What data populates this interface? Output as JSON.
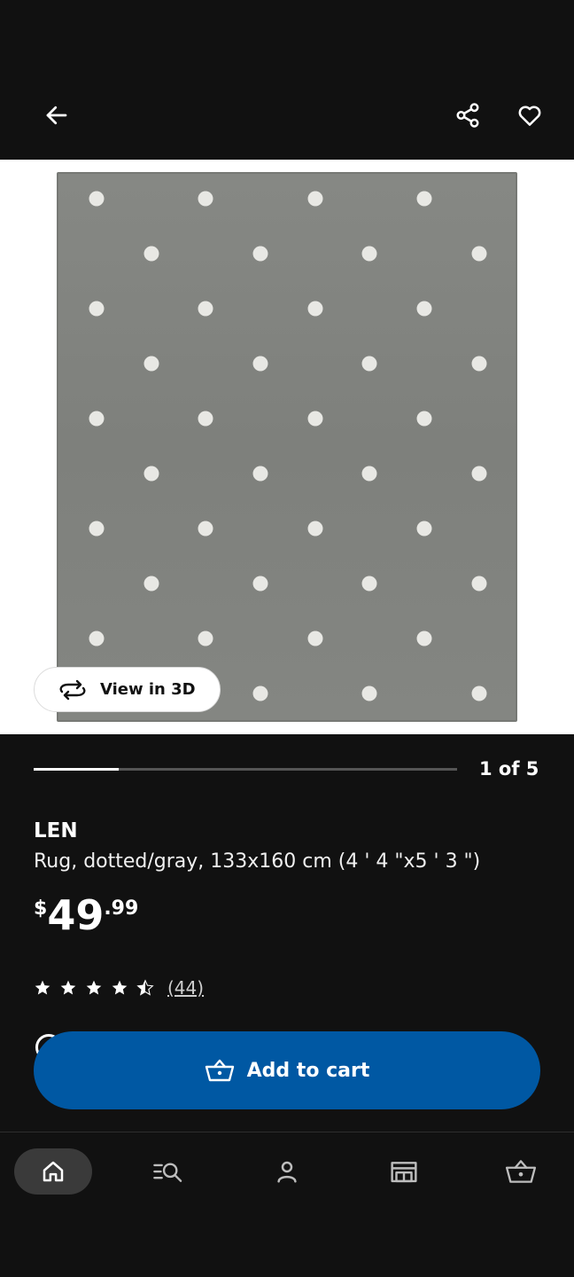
{
  "topbar": {
    "back_icon": "arrow-left-icon",
    "share_icon": "share-icon",
    "favorite_icon": "heart-icon"
  },
  "hero": {
    "view_3d_label": "View in 3D",
    "view_3d_icon": "rotate-3d-icon"
  },
  "gallery": {
    "progress_label": "1 of 5",
    "current": 1,
    "total": 5
  },
  "product": {
    "name": "LEN",
    "description": "Rug, dotted/gray, 133x160 cm (4 ' 4 \"x5 ' 3 \")",
    "price": {
      "currency": "$",
      "integer": "49",
      "decimal": ".99"
    },
    "rating": {
      "value": 4.5,
      "max": 5,
      "count_label": "(44)"
    }
  },
  "cart_button": {
    "label": "Add to cart",
    "icon": "shopping-basket-icon"
  },
  "bottom_nav": {
    "items": [
      {
        "icon": "home-icon",
        "active": true
      },
      {
        "icon": "search-list-icon",
        "active": false
      },
      {
        "icon": "profile-icon",
        "active": false
      },
      {
        "icon": "store-icon",
        "active": false
      },
      {
        "icon": "shopping-basket-icon",
        "active": false
      }
    ]
  },
  "colors": {
    "background": "#111111",
    "accent_blue": "#0058a3",
    "rug_gray": "#828480",
    "dot": "#e8e8e4"
  }
}
